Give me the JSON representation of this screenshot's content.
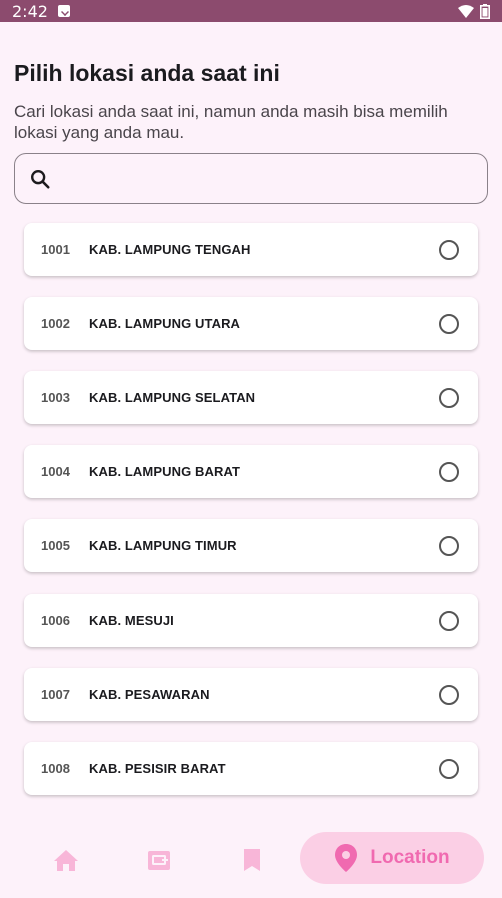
{
  "status_bar": {
    "time": "2:42"
  },
  "header": {
    "title": "Pilih lokasi anda saat ini",
    "subtitle": "Cari lokasi anda saat ini, namun anda masih bisa memilih lokasi yang anda mau."
  },
  "search": {
    "value": "",
    "placeholder": ""
  },
  "locations": [
    {
      "code": "1001",
      "name": "KAB. LAMPUNG TENGAH",
      "selected": false
    },
    {
      "code": "1002",
      "name": "KAB. LAMPUNG UTARA",
      "selected": false
    },
    {
      "code": "1003",
      "name": "KAB. LAMPUNG SELATAN",
      "selected": false
    },
    {
      "code": "1004",
      "name": "KAB. LAMPUNG BARAT",
      "selected": false
    },
    {
      "code": "1005",
      "name": "KAB. LAMPUNG TIMUR",
      "selected": false
    },
    {
      "code": "1006",
      "name": "KAB. MESUJI",
      "selected": false
    },
    {
      "code": "1007",
      "name": "KAB. PESAWARAN",
      "selected": false
    },
    {
      "code": "1008",
      "name": "KAB. PESISIR BARAT",
      "selected": false
    }
  ],
  "bottom_nav": {
    "items": [
      {
        "icon": "home-icon"
      },
      {
        "icon": "wallet-icon"
      },
      {
        "icon": "bookmark-icon"
      },
      {
        "icon": "location-pin-icon",
        "label": "Location",
        "active": true
      }
    ]
  },
  "colors": {
    "status_bar": "#8c4b6e",
    "background": "#fdf2fa",
    "nav_accent": "#f06ab0",
    "nav_active_bg": "#fbcfe5"
  }
}
